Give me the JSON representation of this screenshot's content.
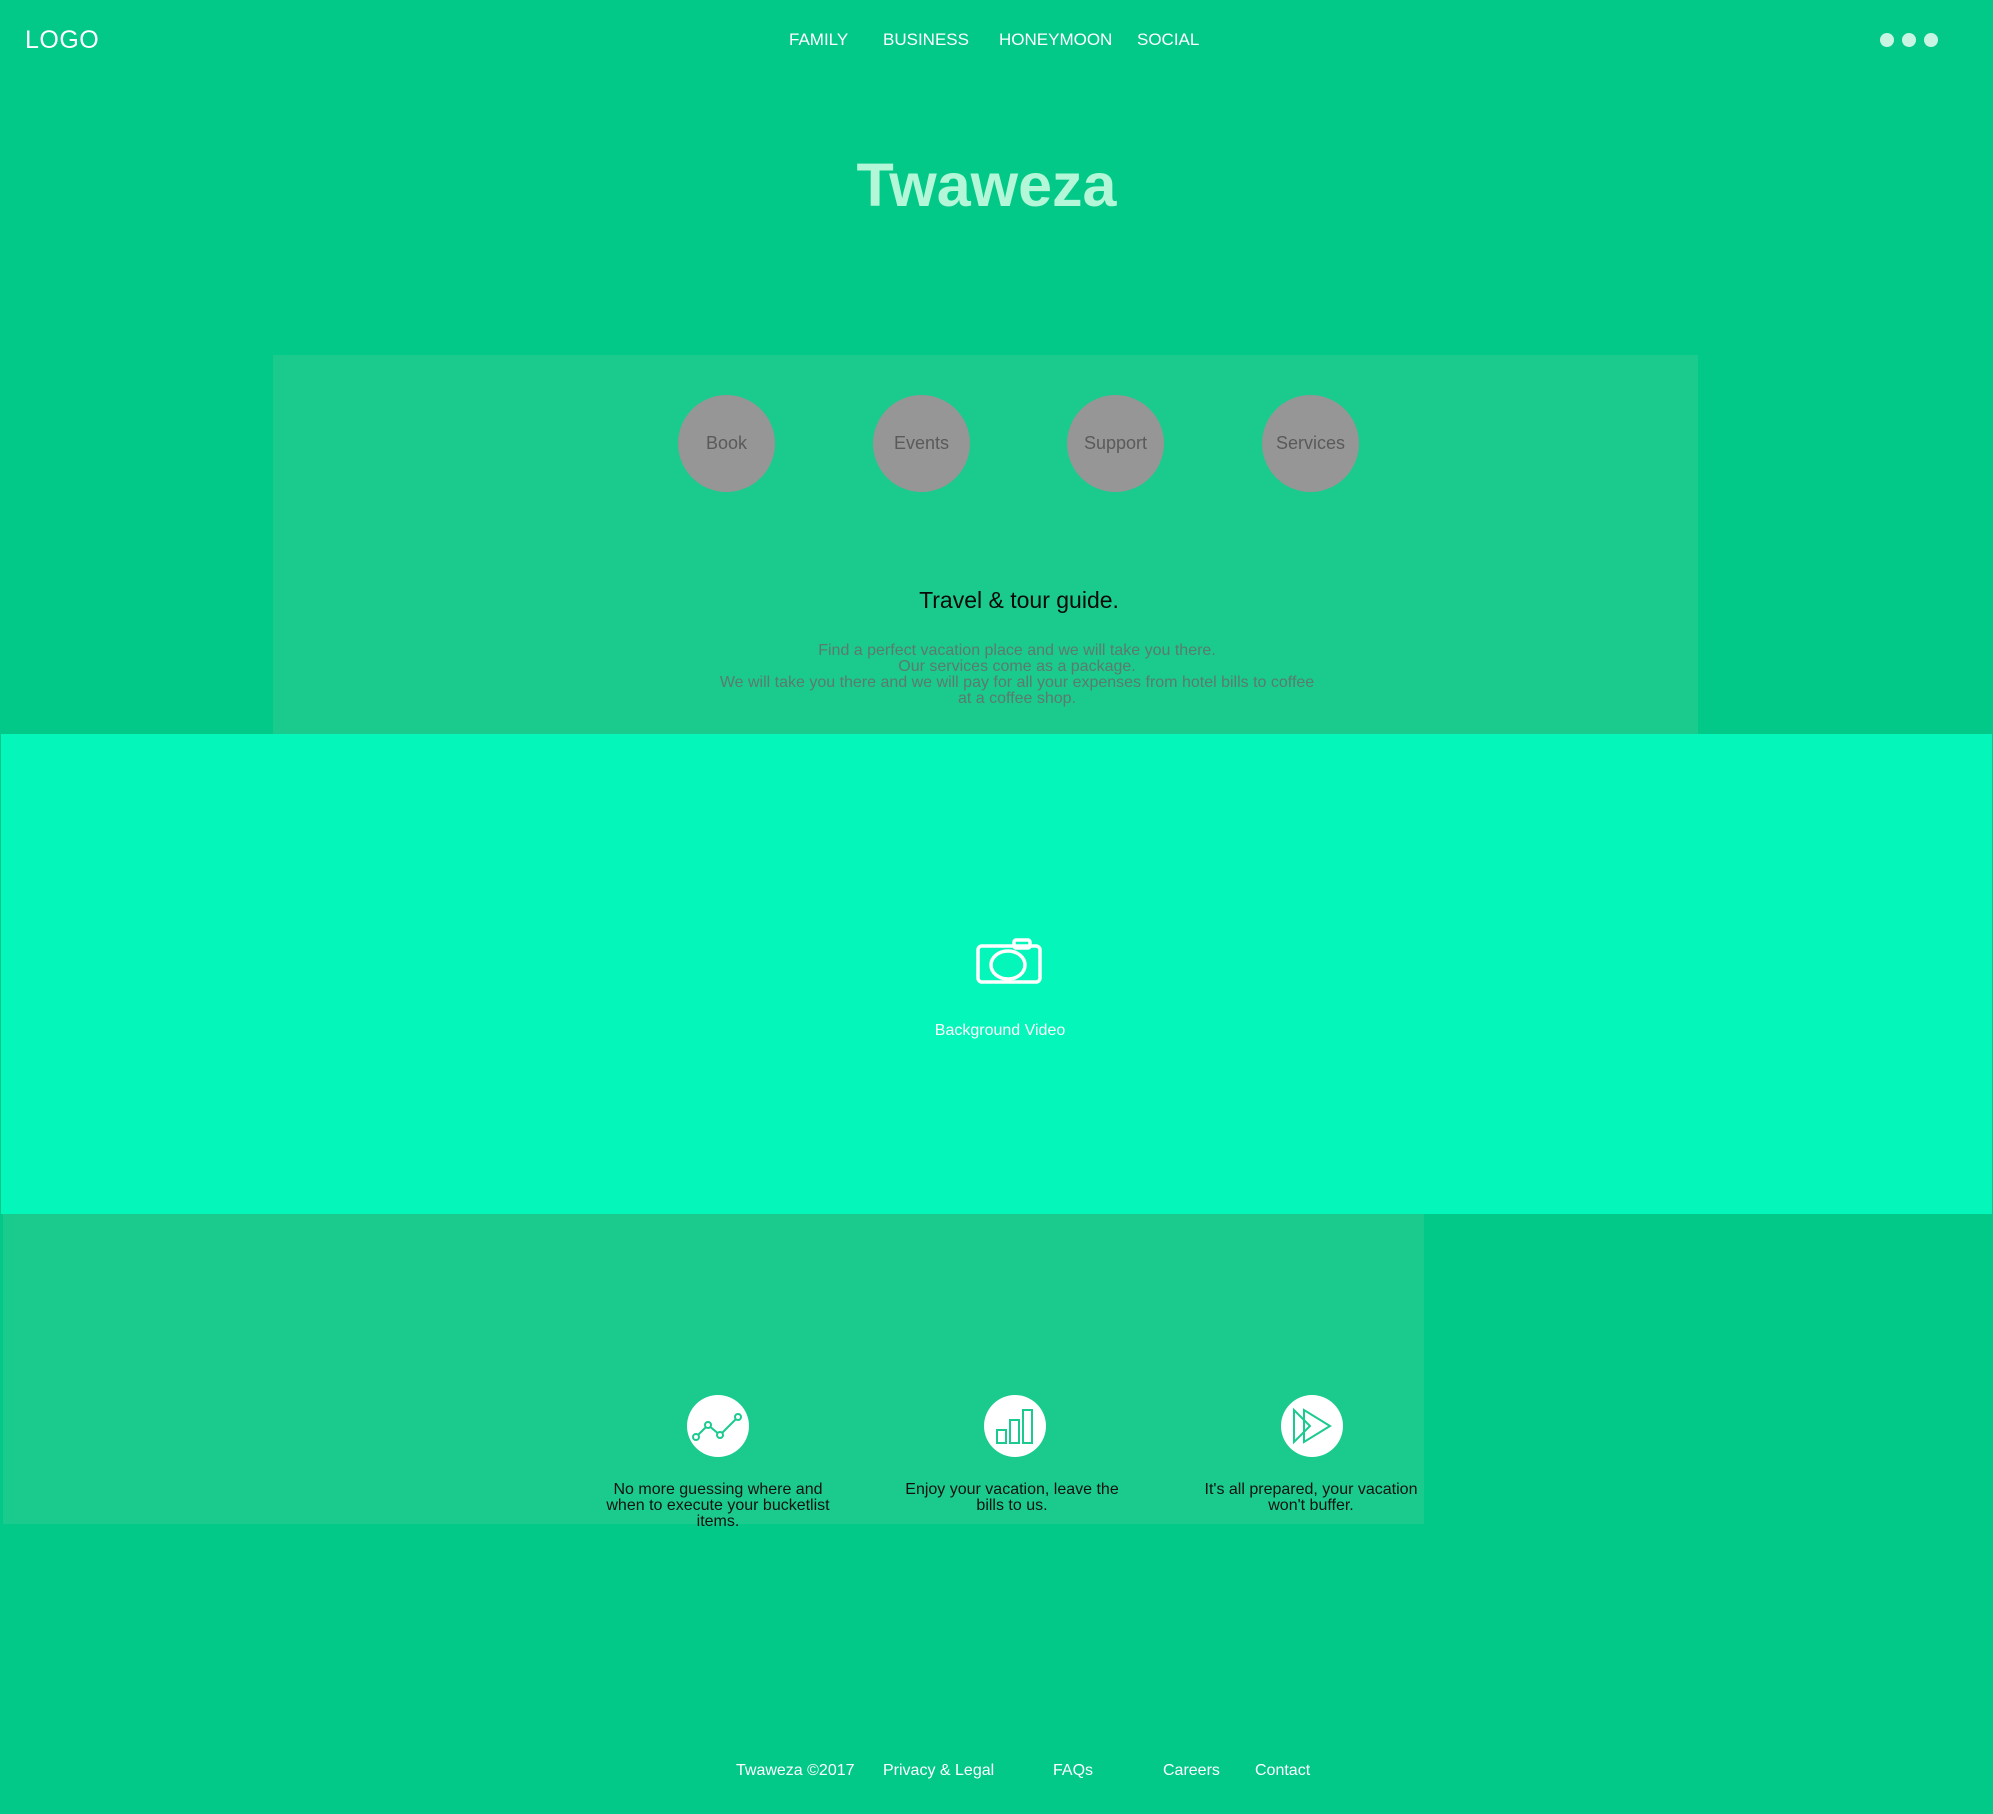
{
  "header": {
    "logo": "LOGO",
    "nav": [
      "FAMILY",
      "BUSINESS",
      "HONEYMOON",
      "SOCIAL"
    ],
    "menu_icon": "more-dots-icon"
  },
  "hero": {
    "title": "Twaweza"
  },
  "panel": {
    "buttons": [
      "Book",
      "Events",
      "Support",
      "Services"
    ],
    "tagline": "Travel & tour guide.",
    "description": [
      "Find a perfect vacation place and we will take you there.",
      "Our services come as a package.",
      "We will take you there and we will pay for all your expenses from hotel bills to coffee",
      "at a coffee shop."
    ]
  },
  "video": {
    "icon": "camera-icon",
    "label": "Background Video"
  },
  "features": [
    {
      "icon": "line-chart-icon",
      "text": "No more guessing where and when to execute your bucketlist items."
    },
    {
      "icon": "bar-chart-icon",
      "text": "Enjoy your vacation, leave the bills to us."
    },
    {
      "icon": "play-forward-icon",
      "text": "It's all prepared, your vacation won't buffer."
    }
  ],
  "footer": {
    "copyright": "Twaweza ©2017",
    "links": [
      "Privacy & Legal",
      "FAQs",
      "Careers",
      "Contact"
    ]
  },
  "colors": {
    "background": "#03c988",
    "panel": "#1acb8d",
    "video": "#04f6bb",
    "title": "#b3f6d8",
    "circle_button": "#969696"
  }
}
